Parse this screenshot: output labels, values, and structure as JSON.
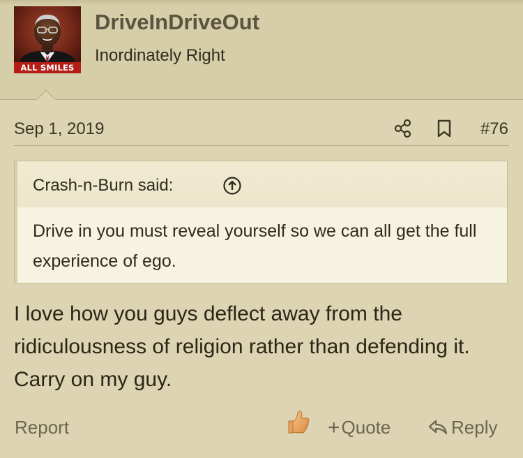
{
  "user": {
    "name": "DriveInDriveOut",
    "title": "Inordinately Right",
    "avatar_caption": "ALL SMILES",
    "avatar_icon": "portrait-avatar"
  },
  "post": {
    "date": "Sep 1, 2019",
    "number": "#76",
    "share_icon": "share-icon",
    "bookmark_icon": "bookmark-icon",
    "body": "I love how you guys deflect away from the ridiculousness of religion rather than defending it. Carry on my guy."
  },
  "quote": {
    "author_line": "Crash-n-Burn said:",
    "up_icon": "arrow-up-circle-icon",
    "text": "Drive in you must reveal yourself so we can all get the full experience of ego."
  },
  "actions": {
    "report": "Report",
    "like_icon": "thumbs-up-icon",
    "quote_plus": "+",
    "quote": "Quote",
    "reply_icon": "reply-arrow-icon",
    "reply": "Reply"
  },
  "colors": {
    "background": "#ddd4b3",
    "header_background": "#d6cda9",
    "quote_background": "#f7f3e1",
    "muted_text": "#6c6650",
    "avatar_caption_background": "#b51d17"
  }
}
